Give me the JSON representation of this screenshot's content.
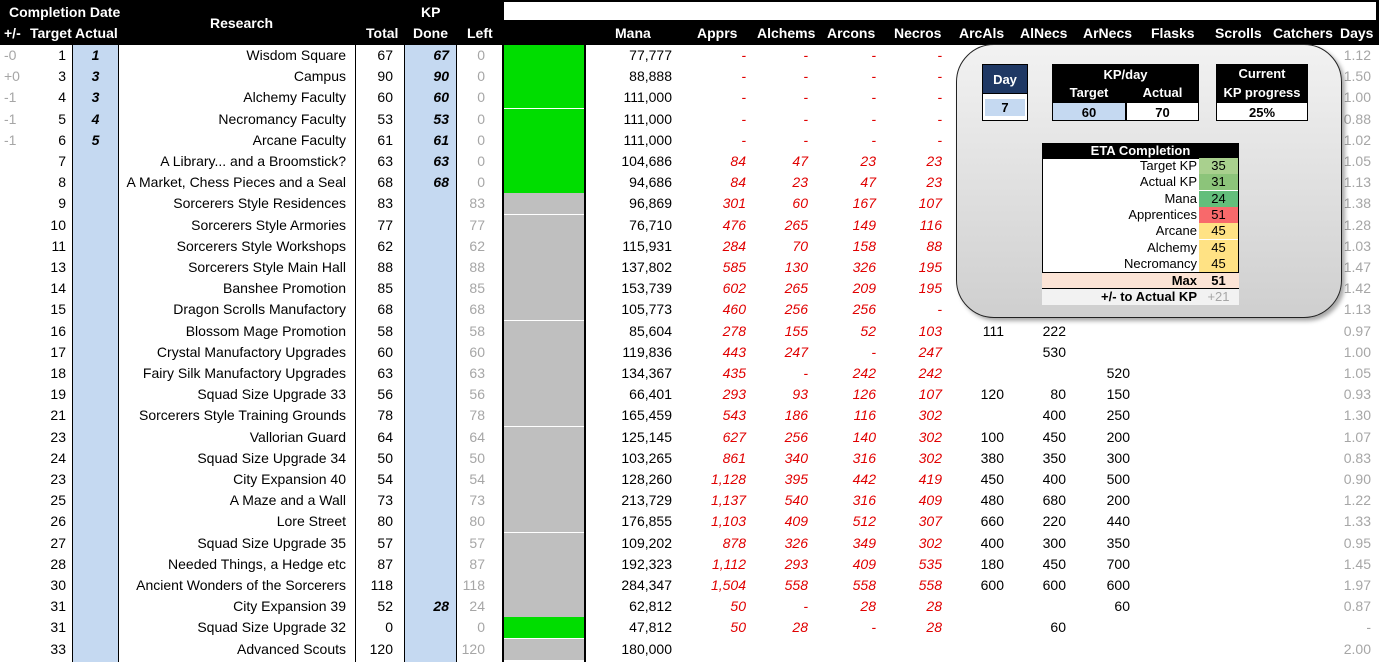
{
  "headers": {
    "completion_date": "Completion Date",
    "plus_minus": "+/-",
    "target": "Target",
    "actual": "Actual",
    "research": "Research",
    "kp": "KP",
    "total": "Total",
    "done": "Done",
    "left": "Left",
    "mana": "Mana",
    "appr": "Apprs",
    "alch": "Alchems",
    "arcon": "Arcons",
    "necro": "Necros",
    "arcal": "ArcAls",
    "alnec": "AlNecs",
    "arnec": "ArNecs",
    "flasks": "Flasks",
    "scrolls": "Scrolls",
    "catchers": "Catchers",
    "days": "Days"
  },
  "colors": {
    "green": "#00dd00",
    "gray": "#bfbfbf",
    "light_blue": "#c5d9f1",
    "red_text": "#e00000"
  },
  "rows": [
    {
      "pm": "-0",
      "target": "1",
      "actual": "1",
      "name": "Wisdom Square",
      "total": "67",
      "done": "67",
      "left": "0",
      "swatch": "green",
      "mana": "77,777",
      "appr": "-",
      "alch": "-",
      "arcon": "-",
      "necro": "-",
      "arcal": "",
      "alnec": "",
      "arnec": "",
      "days": "1.12"
    },
    {
      "pm": "+0",
      "target": "3",
      "actual": "3",
      "name": "Campus",
      "total": "90",
      "done": "90",
      "left": "0",
      "swatch": "green",
      "mana": "88,888",
      "appr": "-",
      "alch": "-",
      "arcon": "-",
      "necro": "-",
      "arcal": "",
      "alnec": "",
      "arnec": "",
      "days": "1.50"
    },
    {
      "pm": "-1",
      "target": "4",
      "actual": "3",
      "name": "Alchemy Faculty",
      "total": "60",
      "done": "60",
      "left": "0",
      "swatch": "green",
      "mana": "111,000",
      "appr": "-",
      "alch": "-",
      "arcon": "-",
      "necro": "-",
      "arcal": "",
      "alnec": "",
      "arnec": "",
      "days": "1.00"
    },
    {
      "pm": "-1",
      "target": "5",
      "actual": "4",
      "name": "Necromancy Faculty",
      "total": "53",
      "done": "53",
      "left": "0",
      "swatch": "green",
      "mana": "111,000",
      "appr": "-",
      "alch": "-",
      "arcon": "-",
      "necro": "-",
      "arcal": "",
      "alnec": "",
      "arnec": "",
      "days": "0.88"
    },
    {
      "pm": "-1",
      "target": "6",
      "actual": "5",
      "name": "Arcane Faculty",
      "total": "61",
      "done": "61",
      "left": "0",
      "swatch": "green",
      "mana": "111,000",
      "appr": "-",
      "alch": "-",
      "arcon": "-",
      "necro": "-",
      "arcal": "",
      "alnec": "",
      "arnec": "",
      "days": "1.02"
    },
    {
      "pm": "",
      "target": "7",
      "actual": "",
      "name": "A Library... and a Broomstick?",
      "total": "63",
      "done": "63",
      "left": "0",
      "swatch": "green",
      "mana": "104,686",
      "appr": "84",
      "alch": "47",
      "arcon": "23",
      "necro": "23",
      "arcal": "",
      "alnec": "",
      "arnec": "",
      "days": "1.05"
    },
    {
      "pm": "",
      "target": "8",
      "actual": "",
      "name": "A Market, Chess Pieces and a Seal",
      "total": "68",
      "done": "68",
      "left": "0",
      "swatch": "green",
      "mana": "94,686",
      "appr": "84",
      "alch": "23",
      "arcon": "47",
      "necro": "23",
      "arcal": "",
      "alnec": "",
      "arnec": "",
      "days": "1.13"
    },
    {
      "pm": "",
      "target": "9",
      "actual": "",
      "name": "Sorcerers Style Residences",
      "total": "83",
      "done": "",
      "left": "83",
      "swatch": "gray",
      "mana": "96,869",
      "appr": "301",
      "alch": "60",
      "arcon": "167",
      "necro": "107",
      "arcal": "",
      "alnec": "",
      "arnec": "",
      "days": "1.38"
    },
    {
      "pm": "",
      "target": "10",
      "actual": "",
      "name": "Sorcerers Style Armories",
      "total": "77",
      "done": "",
      "left": "77",
      "swatch": "gray",
      "mana": "76,710",
      "appr": "476",
      "alch": "265",
      "arcon": "149",
      "necro": "116",
      "arcal": "",
      "alnec": "",
      "arnec": "",
      "days": "1.28"
    },
    {
      "pm": "",
      "target": "11",
      "actual": "",
      "name": "Sorcerers Style Workshops",
      "total": "62",
      "done": "",
      "left": "62",
      "swatch": "gray",
      "mana": "115,931",
      "appr": "284",
      "alch": "70",
      "arcon": "158",
      "necro": "88",
      "arcal": "",
      "alnec": "",
      "arnec": "",
      "days": "1.03"
    },
    {
      "pm": "",
      "target": "13",
      "actual": "",
      "name": "Sorcerers Style Main Hall",
      "total": "88",
      "done": "",
      "left": "88",
      "swatch": "gray",
      "mana": "137,802",
      "appr": "585",
      "alch": "130",
      "arcon": "326",
      "necro": "195",
      "arcal": "",
      "alnec": "",
      "arnec": "",
      "days": "1.47"
    },
    {
      "pm": "",
      "target": "14",
      "actual": "",
      "name": "Banshee Promotion",
      "total": "85",
      "done": "",
      "left": "85",
      "swatch": "gray",
      "mana": "153,739",
      "appr": "602",
      "alch": "265",
      "arcon": "209",
      "necro": "195",
      "arcal": "",
      "alnec": "",
      "arnec": "",
      "days": "1.42"
    },
    {
      "pm": "",
      "target": "15",
      "actual": "",
      "name": "Dragon Scrolls Manufactory",
      "total": "68",
      "done": "",
      "left": "68",
      "swatch": "gray",
      "mana": "105,773",
      "appr": "460",
      "alch": "256",
      "arcon": "256",
      "necro": "-",
      "arcal": "",
      "alnec": "",
      "arnec": "",
      "days": "1.13"
    },
    {
      "pm": "",
      "target": "16",
      "actual": "",
      "name": "Blossom Mage Promotion",
      "total": "58",
      "done": "",
      "left": "58",
      "swatch": "gray",
      "mana": "85,604",
      "appr": "278",
      "alch": "155",
      "arcon": "52",
      "necro": "103",
      "arcal": "111",
      "alnec": "222",
      "arnec": "",
      "days": "0.97"
    },
    {
      "pm": "",
      "target": "17",
      "actual": "",
      "name": "Crystal Manufactory Upgrades",
      "total": "60",
      "done": "",
      "left": "60",
      "swatch": "gray",
      "mana": "119,836",
      "appr": "443",
      "alch": "247",
      "arcon": "-",
      "necro": "247",
      "arcal": "",
      "alnec": "530",
      "arnec": "",
      "days": "1.00"
    },
    {
      "pm": "",
      "target": "18",
      "actual": "",
      "name": "Fairy Silk Manufactory Upgrades",
      "total": "63",
      "done": "",
      "left": "63",
      "swatch": "gray",
      "mana": "134,367",
      "appr": "435",
      "alch": "-",
      "arcon": "242",
      "necro": "242",
      "arcal": "",
      "alnec": "",
      "arnec": "520",
      "days": "1.05"
    },
    {
      "pm": "",
      "target": "19",
      "actual": "",
      "name": "Squad Size Upgrade 33",
      "total": "56",
      "done": "",
      "left": "56",
      "swatch": "gray",
      "mana": "66,401",
      "appr": "293",
      "alch": "93",
      "arcon": "126",
      "necro": "107",
      "arcal": "120",
      "alnec": "80",
      "arnec": "150",
      "days": "0.93"
    },
    {
      "pm": "",
      "target": "21",
      "actual": "",
      "name": "Sorcerers Style Training Grounds",
      "total": "78",
      "done": "",
      "left": "78",
      "swatch": "gray",
      "mana": "165,459",
      "appr": "543",
      "alch": "186",
      "arcon": "116",
      "necro": "302",
      "arcal": "",
      "alnec": "400",
      "arnec": "250",
      "days": "1.30"
    },
    {
      "pm": "",
      "target": "23",
      "actual": "",
      "name": "Vallorian Guard",
      "total": "64",
      "done": "",
      "left": "64",
      "swatch": "gray",
      "mana": "125,145",
      "appr": "627",
      "alch": "256",
      "arcon": "140",
      "necro": "302",
      "arcal": "100",
      "alnec": "450",
      "arnec": "200",
      "days": "1.07"
    },
    {
      "pm": "",
      "target": "24",
      "actual": "",
      "name": "Squad Size Upgrade 34",
      "total": "50",
      "done": "",
      "left": "50",
      "swatch": "gray",
      "mana": "103,265",
      "appr": "861",
      "alch": "340",
      "arcon": "316",
      "necro": "302",
      "arcal": "380",
      "alnec": "350",
      "arnec": "300",
      "days": "0.83"
    },
    {
      "pm": "",
      "target": "23",
      "actual": "",
      "name": "City Expansion 40",
      "total": "54",
      "done": "",
      "left": "54",
      "swatch": "gray",
      "mana": "128,260",
      "appr": "1,128",
      "alch": "395",
      "arcon": "442",
      "necro": "419",
      "arcal": "450",
      "alnec": "400",
      "arnec": "500",
      "days": "0.90"
    },
    {
      "pm": "",
      "target": "25",
      "actual": "",
      "name": "A Maze and a Wall",
      "total": "73",
      "done": "",
      "left": "73",
      "swatch": "gray",
      "mana": "213,729",
      "appr": "1,137",
      "alch": "540",
      "arcon": "316",
      "necro": "409",
      "arcal": "480",
      "alnec": "680",
      "arnec": "200",
      "days": "1.22"
    },
    {
      "pm": "",
      "target": "26",
      "actual": "",
      "name": "Lore Street",
      "total": "80",
      "done": "",
      "left": "80",
      "swatch": "gray",
      "mana": "176,855",
      "appr": "1,103",
      "alch": "409",
      "arcon": "512",
      "necro": "307",
      "arcal": "660",
      "alnec": "220",
      "arnec": "440",
      "days": "1.33"
    },
    {
      "pm": "",
      "target": "27",
      "actual": "",
      "name": "Squad Size Upgrade 35",
      "total": "57",
      "done": "",
      "left": "57",
      "swatch": "gray",
      "mana": "109,202",
      "appr": "878",
      "alch": "326",
      "arcon": "349",
      "necro": "302",
      "arcal": "400",
      "alnec": "300",
      "arnec": "350",
      "days": "0.95"
    },
    {
      "pm": "",
      "target": "28",
      "actual": "",
      "name": "Needed Things, a Hedge etc",
      "total": "87",
      "done": "",
      "left": "87",
      "swatch": "gray",
      "mana": "192,323",
      "appr": "1,112",
      "alch": "293",
      "arcon": "409",
      "necro": "535",
      "arcal": "180",
      "alnec": "450",
      "arnec": "700",
      "days": "1.45"
    },
    {
      "pm": "",
      "target": "30",
      "actual": "",
      "name": "Ancient Wonders of the Sorcerers",
      "total": "118",
      "done": "",
      "left": "118",
      "swatch": "gray",
      "mana": "284,347",
      "appr": "1,504",
      "alch": "558",
      "arcon": "558",
      "necro": "558",
      "arcal": "600",
      "alnec": "600",
      "arnec": "600",
      "days": "1.97"
    },
    {
      "pm": "",
      "target": "31",
      "actual": "",
      "name": "City Expansion 39",
      "total": "52",
      "done": "28",
      "left": "24",
      "swatch": "gray",
      "mana": "62,812",
      "appr": "50",
      "alch": "-",
      "arcon": "28",
      "necro": "28",
      "arcal": "",
      "alnec": "",
      "arnec": "60",
      "days": "0.87"
    },
    {
      "pm": "",
      "target": "31",
      "actual": "",
      "name": "Squad Size Upgrade 32",
      "total": "0",
      "done": "",
      "left": "0",
      "swatch": "green",
      "mana": "47,812",
      "appr": "50",
      "alch": "28",
      "arcon": "-",
      "necro": "28",
      "arcal": "",
      "alnec": "60",
      "arnec": "",
      "days": "-"
    },
    {
      "pm": "",
      "target": "33",
      "actual": "",
      "name": "Advanced Scouts",
      "total": "120",
      "done": "",
      "left": "120",
      "swatch": "gray",
      "mana": "180,000",
      "appr": "",
      "alch": "",
      "arcon": "",
      "necro": "",
      "arcal": "",
      "alnec": "",
      "arnec": "",
      "days": "2.00"
    }
  ],
  "panel": {
    "day_label": "Day",
    "day_value": "7",
    "kpday_label": "KP/day",
    "kpday_target_label": "Target",
    "kpday_actual_label": "Actual",
    "kpday_target": "60",
    "kpday_actual": "70",
    "current_label1": "Current",
    "current_label2": "KP progress",
    "current_value": "25%",
    "eta_title": "ETA Completion",
    "eta_rows": [
      {
        "label": "Target KP",
        "value": "35",
        "color": "#a9d08e"
      },
      {
        "label": "Actual KP",
        "value": "31",
        "color": "#8cc47a"
      },
      {
        "label": "Mana",
        "value": "24",
        "color": "#63be7b"
      },
      {
        "label": "Apprentices",
        "value": "51",
        "color": "#f8696b"
      },
      {
        "label": "Arcane",
        "value": "45",
        "color": "#ffe284"
      },
      {
        "label": "Alchemy",
        "value": "45",
        "color": "#ffe284"
      },
      {
        "label": "Necromancy",
        "value": "45",
        "color": "#ffe284"
      }
    ],
    "max_label": "Max",
    "max_value": "51",
    "diff_label": "+/- to Actual KP",
    "diff_value": "+21"
  }
}
